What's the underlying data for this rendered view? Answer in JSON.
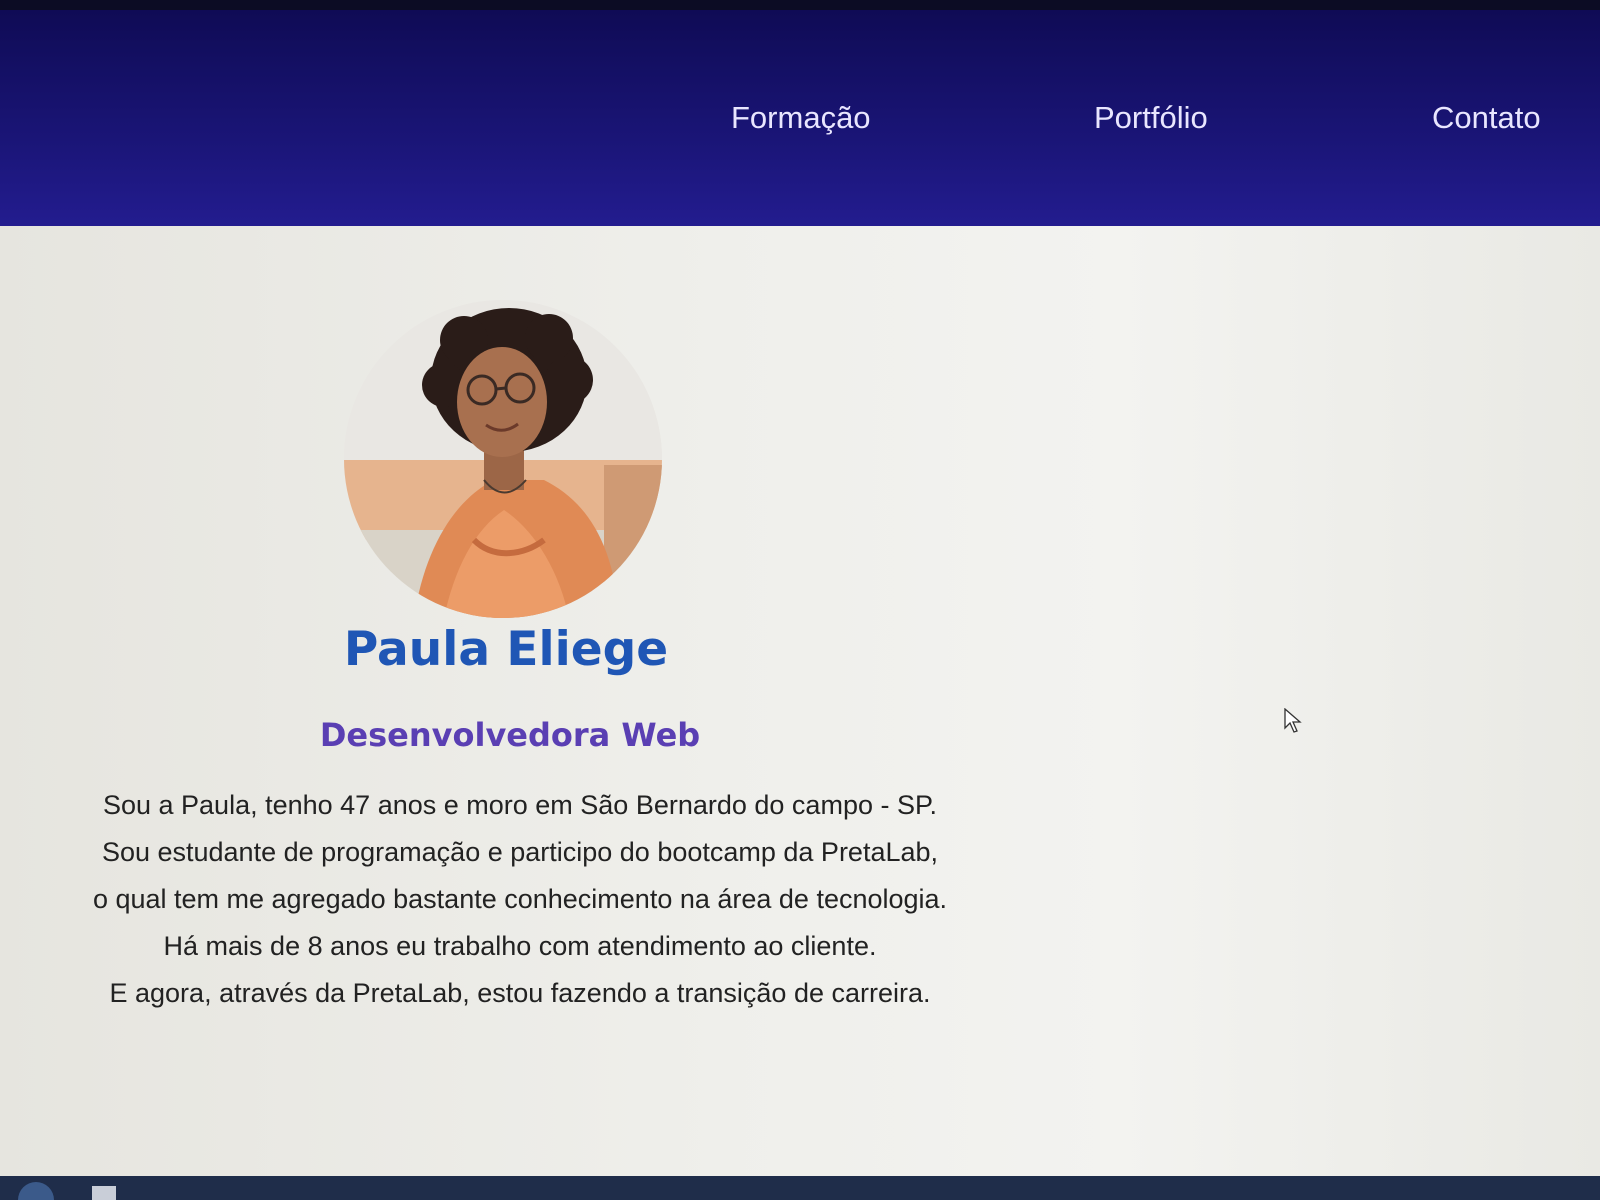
{
  "nav": {
    "items": [
      {
        "label": "Formação"
      },
      {
        "label": "Portfólio"
      },
      {
        "label": "Contato"
      }
    ]
  },
  "profile": {
    "name": "Paula Eliege",
    "role": "Desenvolvedora Web",
    "photo_icon": "profile-photo",
    "bio_lines": [
      "Sou a Paula, tenho 47 anos e moro em São Bernardo do campo - SP.",
      "Sou estudante de programação e participo do bootcamp da PretaLab,",
      "o qual tem me agregado bastante conhecimento na área de tecnologia.",
      "Há mais de 8 anos eu trabalho com atendimento ao cliente.",
      "E agora, através da PretaLab, estou fazendo a transição de carreira."
    ]
  },
  "colors": {
    "nav_background": "#1a1577",
    "name": "#1f56b5",
    "role": "#5a3fb3",
    "text": "#222222"
  }
}
